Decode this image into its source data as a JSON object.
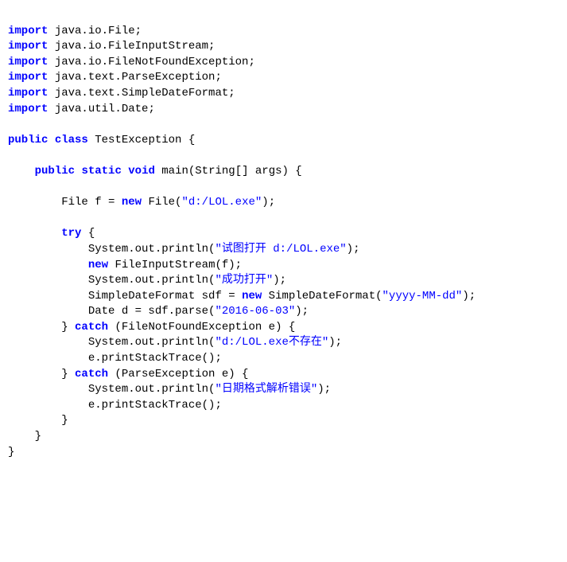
{
  "tokens": [
    {
      "c": "kw",
      "t": "import"
    },
    {
      "c": "t",
      "t": " java.io.File;\n"
    },
    {
      "c": "kw",
      "t": "import"
    },
    {
      "c": "t",
      "t": " java.io.FileInputStream;\n"
    },
    {
      "c": "kw",
      "t": "import"
    },
    {
      "c": "t",
      "t": " java.io.FileNotFoundException;\n"
    },
    {
      "c": "kw",
      "t": "import"
    },
    {
      "c": "t",
      "t": " java.text.ParseException;\n"
    },
    {
      "c": "kw",
      "t": "import"
    },
    {
      "c": "t",
      "t": " java.text.SimpleDateFormat;\n"
    },
    {
      "c": "kw",
      "t": "import"
    },
    {
      "c": "t",
      "t": " java.util.Date;\n"
    },
    {
      "c": "t",
      "t": "\n"
    },
    {
      "c": "kw",
      "t": "public"
    },
    {
      "c": "t",
      "t": " "
    },
    {
      "c": "kw",
      "t": "class"
    },
    {
      "c": "t",
      "t": " TestException {\n"
    },
    {
      "c": "t",
      "t": "\n"
    },
    {
      "c": "t",
      "t": "    "
    },
    {
      "c": "kw",
      "t": "public"
    },
    {
      "c": "t",
      "t": " "
    },
    {
      "c": "kw",
      "t": "static"
    },
    {
      "c": "t",
      "t": " "
    },
    {
      "c": "kw",
      "t": "void"
    },
    {
      "c": "t",
      "t": " main(String[] args) {\n"
    },
    {
      "c": "t",
      "t": "\n"
    },
    {
      "c": "t",
      "t": "        File f = "
    },
    {
      "c": "kw",
      "t": "new"
    },
    {
      "c": "t",
      "t": " File("
    },
    {
      "c": "str",
      "t": "\"d:/LOL.exe\""
    },
    {
      "c": "t",
      "t": ");\n"
    },
    {
      "c": "t",
      "t": "\n"
    },
    {
      "c": "t",
      "t": "        "
    },
    {
      "c": "kw",
      "t": "try"
    },
    {
      "c": "t",
      "t": " {\n"
    },
    {
      "c": "t",
      "t": "            System.out.println("
    },
    {
      "c": "str",
      "t": "\"试图打开 d:/LOL.exe\""
    },
    {
      "c": "t",
      "t": ");\n"
    },
    {
      "c": "t",
      "t": "            "
    },
    {
      "c": "kw",
      "t": "new"
    },
    {
      "c": "t",
      "t": " FileInputStream(f);\n"
    },
    {
      "c": "t",
      "t": "            System.out.println("
    },
    {
      "c": "str",
      "t": "\"成功打开\""
    },
    {
      "c": "t",
      "t": ");\n"
    },
    {
      "c": "t",
      "t": "            SimpleDateFormat sdf = "
    },
    {
      "c": "kw",
      "t": "new"
    },
    {
      "c": "t",
      "t": " SimpleDateFormat("
    },
    {
      "c": "str",
      "t": "\"yyyy-MM-dd\""
    },
    {
      "c": "t",
      "t": ");\n"
    },
    {
      "c": "t",
      "t": "            Date d = sdf.parse("
    },
    {
      "c": "str",
      "t": "\"2016-06-03\""
    },
    {
      "c": "t",
      "t": ");\n"
    },
    {
      "c": "t",
      "t": "        } "
    },
    {
      "c": "kw",
      "t": "catch"
    },
    {
      "c": "t",
      "t": " (FileNotFoundException e) {\n"
    },
    {
      "c": "t",
      "t": "            System.out.println("
    },
    {
      "c": "str",
      "t": "\"d:/LOL.exe不存在\""
    },
    {
      "c": "t",
      "t": ");\n"
    },
    {
      "c": "t",
      "t": "            e.printStackTrace();\n"
    },
    {
      "c": "t",
      "t": "        } "
    },
    {
      "c": "kw",
      "t": "catch"
    },
    {
      "c": "t",
      "t": " (ParseException e) {\n"
    },
    {
      "c": "t",
      "t": "            System.out.println("
    },
    {
      "c": "str",
      "t": "\"日期格式解析错误\""
    },
    {
      "c": "t",
      "t": ");\n"
    },
    {
      "c": "t",
      "t": "            e.printStackTrace();\n"
    },
    {
      "c": "t",
      "t": "        }\n"
    },
    {
      "c": "t",
      "t": "    }\n"
    },
    {
      "c": "t",
      "t": "}\n"
    }
  ]
}
